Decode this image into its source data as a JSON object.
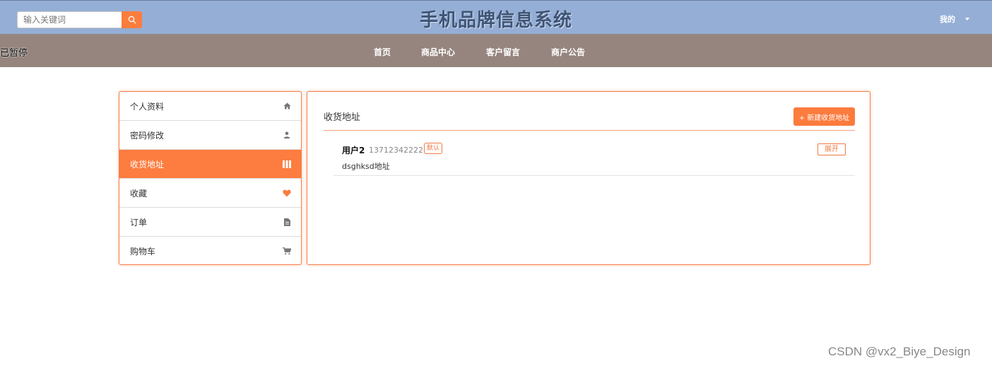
{
  "header": {
    "search_placeholder": "输入关键词",
    "site_title": "手机品牌信息系统",
    "user_menu_label": "我的"
  },
  "nav": {
    "paused_label": "已暂停",
    "items": [
      "首页",
      "商品中心",
      "客户留言",
      "商户公告"
    ]
  },
  "sidebar": {
    "items": [
      {
        "label": "个人资料",
        "icon": "home-icon"
      },
      {
        "label": "密码修改",
        "icon": "user-icon"
      },
      {
        "label": "收货地址",
        "icon": "columns-icon",
        "active": true
      },
      {
        "label": "收藏",
        "icon": "heart-icon"
      },
      {
        "label": "订单",
        "icon": "file-icon"
      },
      {
        "label": "购物车",
        "icon": "cart-icon"
      }
    ]
  },
  "main": {
    "title": "收货地址",
    "add_button": "+ 新建收货地址",
    "addresses": [
      {
        "name": "用户2",
        "phone": "13712342222",
        "default_badge": "默认",
        "detail": "dsghksd地址",
        "expand_label": "展开"
      }
    ]
  },
  "watermark": "CSDN @vx2_Biye_Design",
  "colors": {
    "topbar": "#95aed5",
    "navbar": "#95857e",
    "accent": "#fd7c3f",
    "title": "#3f5577"
  }
}
